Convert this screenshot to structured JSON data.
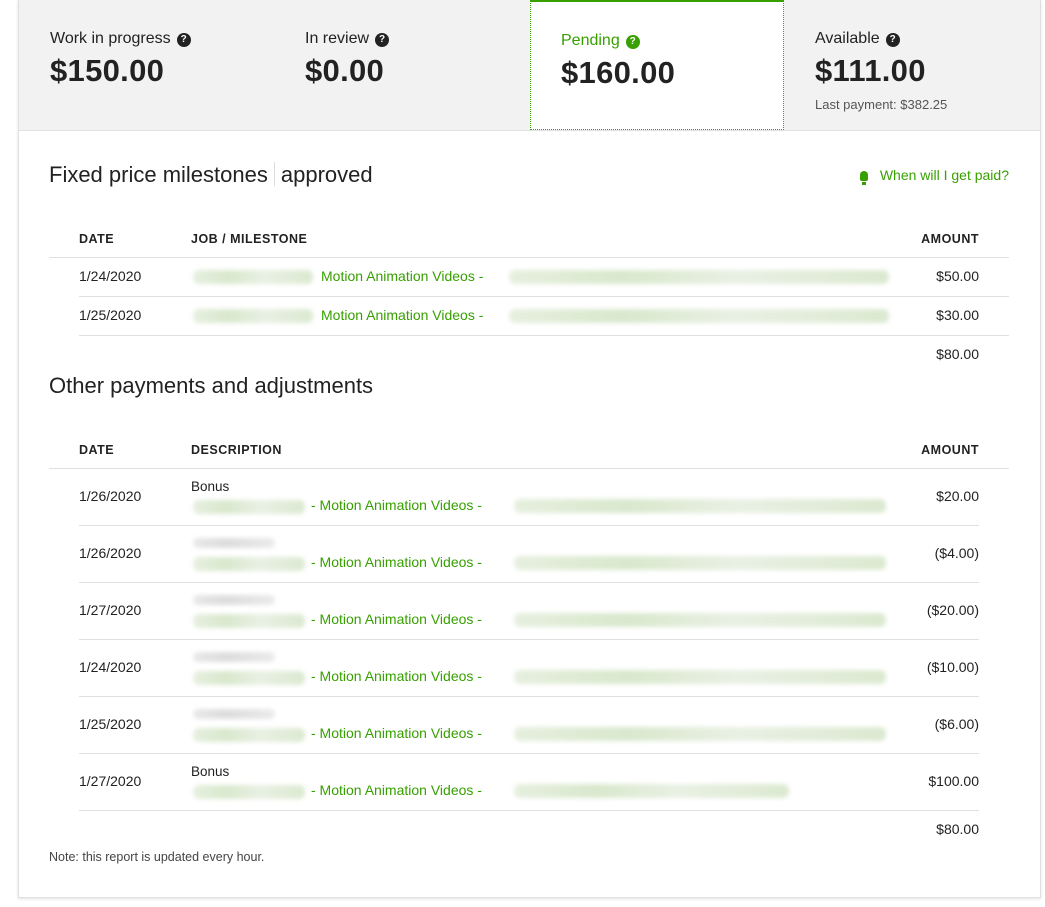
{
  "summary": {
    "work_in_progress": {
      "label": "Work in progress",
      "value": "$150.00"
    },
    "in_review": {
      "label": "In review",
      "value": "$0.00"
    },
    "pending": {
      "label": "Pending",
      "value": "$160.00"
    },
    "available": {
      "label": "Available",
      "value": "$111.00",
      "sub": "Last payment: $382.25"
    }
  },
  "milestones": {
    "title": "Fixed price milestones",
    "status": "approved",
    "help_link": "When will I get paid?",
    "columns": {
      "date": "DATE",
      "job": "JOB / MILESTONE",
      "amount": "AMOUNT"
    },
    "rows": [
      {
        "date": "1/24/2020",
        "job": "Motion Animation Videos -",
        "amount": "$50.00"
      },
      {
        "date": "1/25/2020",
        "job": "Motion Animation Videos -",
        "amount": "$30.00"
      }
    ],
    "total": "$80.00"
  },
  "other": {
    "title": "Other payments and adjustments",
    "columns": {
      "date": "DATE",
      "description": "DESCRIPTION",
      "amount": "AMOUNT"
    },
    "rows": [
      {
        "date": "1/26/2020",
        "top": "Bonus",
        "job": "- Motion Animation Videos -",
        "amount": "$20.00"
      },
      {
        "date": "1/26/2020",
        "top": "",
        "job": "- Motion Animation Videos -",
        "amount": "($4.00)"
      },
      {
        "date": "1/27/2020",
        "top": "",
        "job": "- Motion Animation Videos -",
        "amount": "($20.00)"
      },
      {
        "date": "1/24/2020",
        "top": "",
        "job": "- Motion Animation Videos -",
        "amount": "($10.00)"
      },
      {
        "date": "1/25/2020",
        "top": "",
        "job": "- Motion Animation Videos -",
        "amount": "($6.00)"
      },
      {
        "date": "1/27/2020",
        "top": "Bonus",
        "job": "- Motion Animation Videos -",
        "amount": "$100.00"
      }
    ],
    "total": "$80.00"
  },
  "note": "Note: this report is updated every hour.",
  "colors": {
    "accent": "#37a000",
    "text": "#222222",
    "summary_bg": "#f2f2f2"
  },
  "icons": {
    "help": "question-circle-icon",
    "tip": "lightbulb-icon"
  }
}
